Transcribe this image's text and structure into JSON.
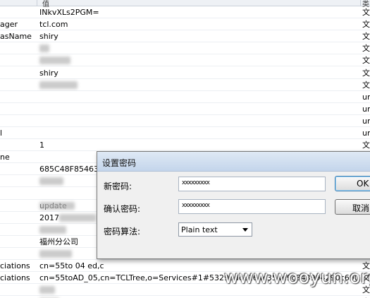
{
  "header": {
    "value_col": "值",
    "type_col": "类"
  },
  "rows": [
    {
      "name": "",
      "value": "INkvXLs2PGM=",
      "type": "文"
    },
    {
      "name": "ager",
      "value": "tcl.com",
      "type": "文"
    },
    {
      "name": "asName",
      "value": "shiry",
      "type": "文"
    },
    {
      "name": "",
      "value": "",
      "type": "文"
    },
    {
      "name": "",
      "value": "",
      "type": "文"
    },
    {
      "name": "",
      "value": "shiry",
      "type": "文"
    },
    {
      "name": "",
      "value": "",
      "type": "文"
    },
    {
      "name": "",
      "value": "",
      "type": "ur"
    },
    {
      "name": "",
      "value": "",
      "type": "ur"
    },
    {
      "name": "",
      "value": "",
      "type": "ur"
    },
    {
      "name": "l",
      "value": "",
      "type": "ur"
    },
    {
      "name": "",
      "value": "1",
      "type": "文"
    },
    {
      "name": "ne",
      "value": "",
      "type": "ur"
    },
    {
      "name": "",
      "value": "685C48F854632E",
      "type": "文"
    },
    {
      "name": "",
      "value": "",
      "type": "文"
    },
    {
      "name": "",
      "value": "",
      "type": "文"
    },
    {
      "name": "",
      "value": "update",
      "type": "文"
    },
    {
      "name": "",
      "value": "2017",
      "type": "文"
    },
    {
      "name": "",
      "value": "",
      "type": "文"
    },
    {
      "name": "",
      "value": "福州分公司",
      "type": "文"
    },
    {
      "name": "",
      "value": "",
      "type": "文"
    },
    {
      "name": "ciations",
      "value": "cn=55to 04 ed,c",
      "type": "文"
    },
    {
      "name": "ciations",
      "value": "cn=55toAD_05,cn=TCLTree,o=Services#1#5329adc2164c354e9c843994290c6902",
      "type": "文"
    },
    {
      "name": "",
      "value": "",
      "type": "文"
    },
    {
      "name": "",
      "value": "",
      "type": "文"
    }
  ],
  "dialog": {
    "title": "设置密码",
    "new_password_label": "新密码:",
    "new_password_value": "xxxxxxxxx",
    "confirm_password_label": "确认密码:",
    "confirm_password_value": "xxxxxxxxx",
    "algorithm_label": "密码算法:",
    "algorithm_value": "Plain text",
    "ok_label": "OK",
    "cancel_label": "取消"
  },
  "watermark": "www.wooyun.org"
}
